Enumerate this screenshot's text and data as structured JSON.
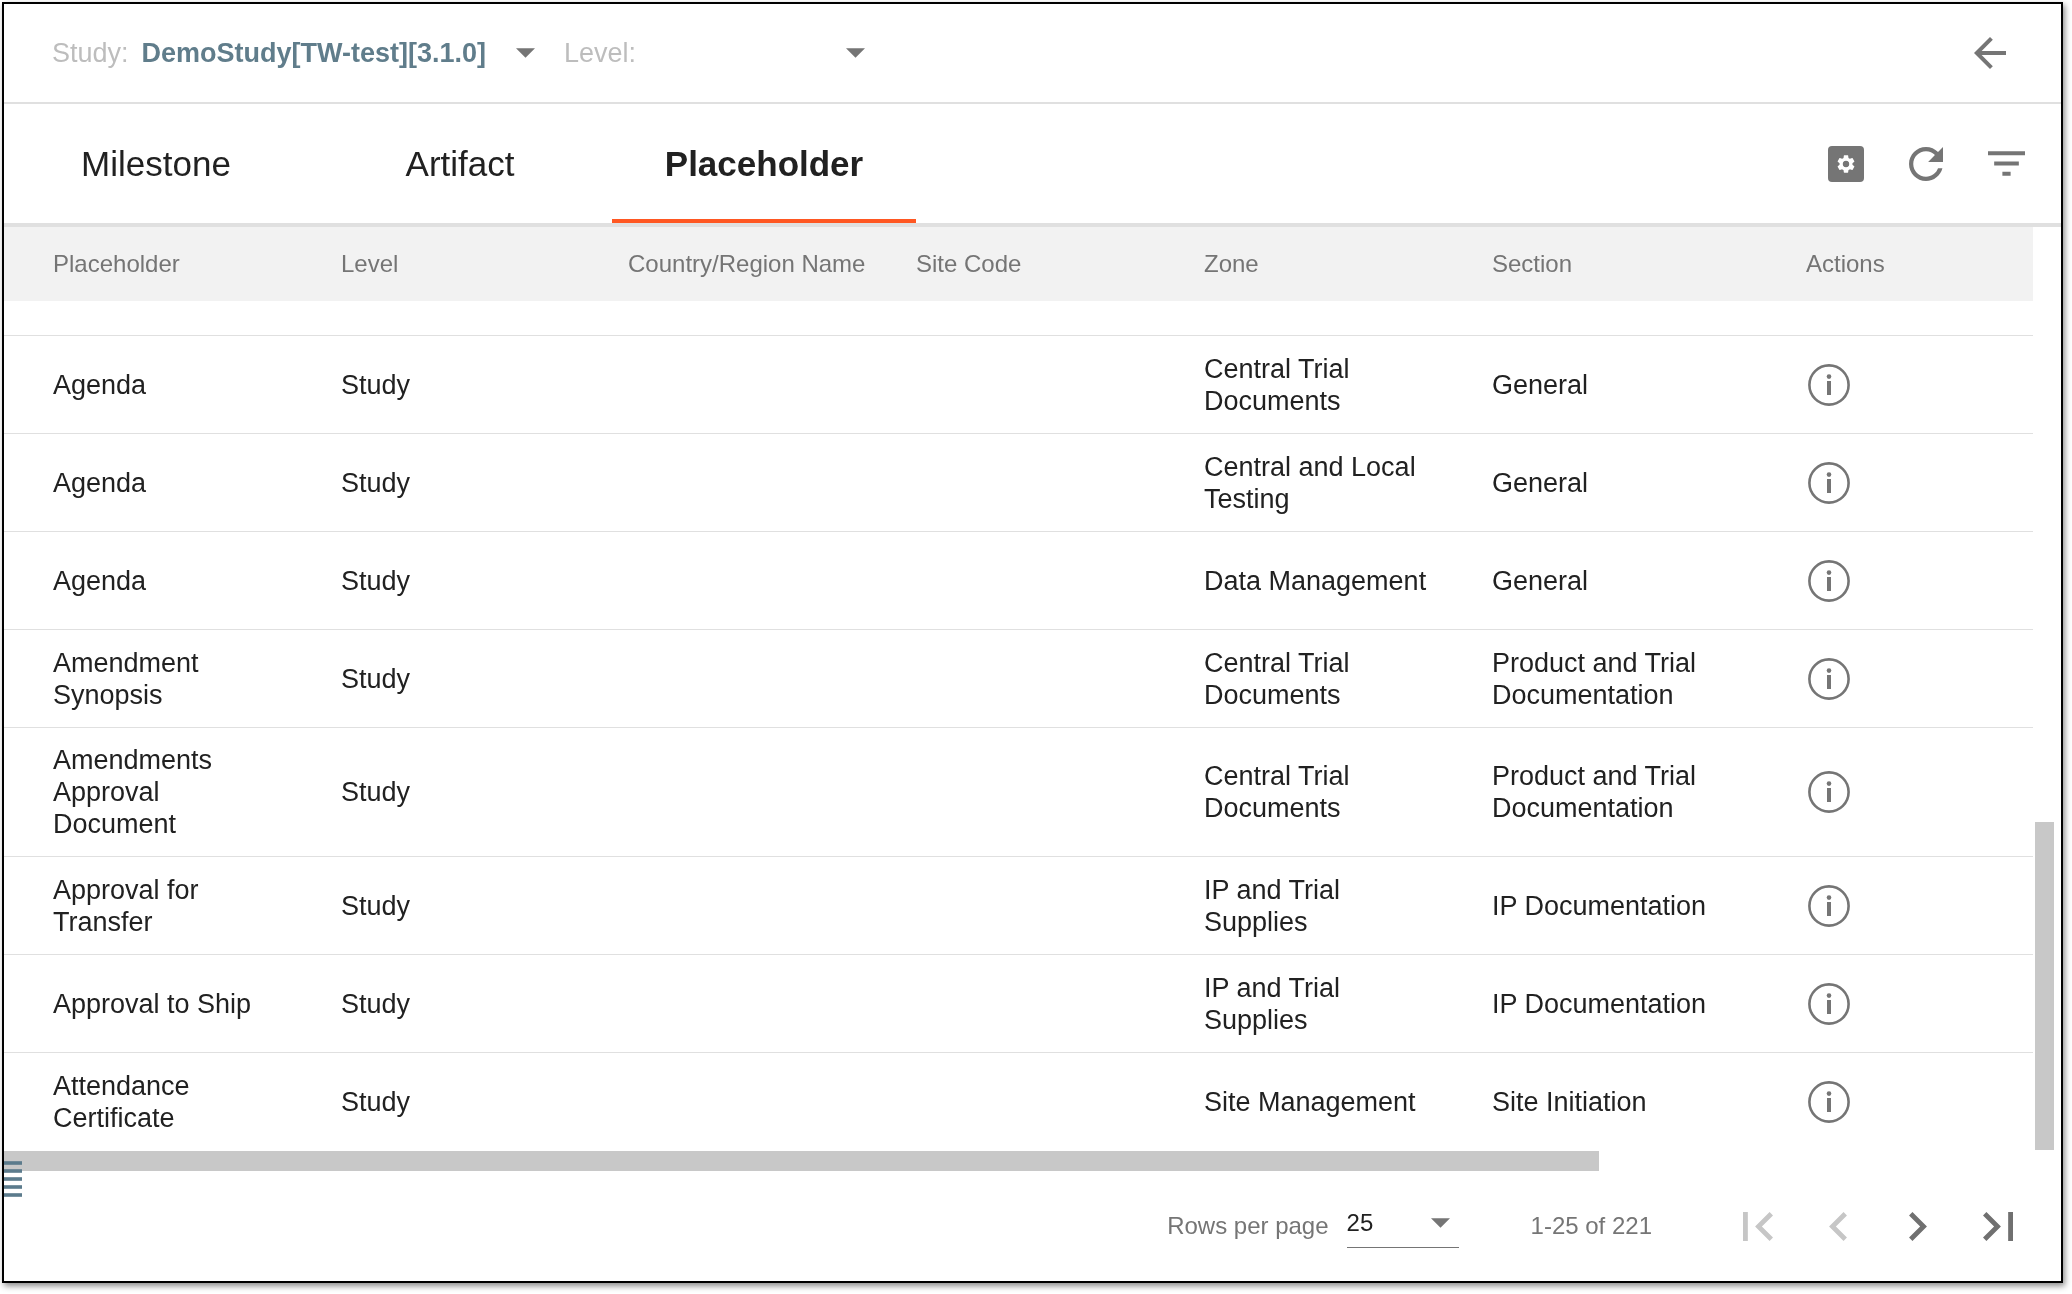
{
  "top_bar": {
    "study_select": {
      "label": "Study:",
      "value": "DemoStudy[TW-test][3.1.0]"
    },
    "level_select": {
      "label": "Level:"
    }
  },
  "tabs": [
    {
      "label": "Milestone",
      "selected": false
    },
    {
      "label": "Artifact",
      "selected": false
    },
    {
      "label": "Placeholder",
      "selected": true
    }
  ],
  "table": {
    "columns": [
      "Placeholder",
      "Level",
      "Country/Region Name",
      "Site Code",
      "Zone",
      "Section",
      "Actions"
    ],
    "rows": [
      {
        "placeholder": "Agenda",
        "level": "Study",
        "zone": "Central Trial Documents",
        "section": "General"
      },
      {
        "placeholder": "Agenda",
        "level": "Study",
        "zone": "Central and Local Testing",
        "section": "General"
      },
      {
        "placeholder": "Agenda",
        "level": "Study",
        "zone": "Data Management",
        "section": "General"
      },
      {
        "placeholder": "Amendment Synopsis",
        "level": "Study",
        "zone": "Central Trial Documents",
        "section": "Product and Trial Documentation"
      },
      {
        "placeholder": "Amendments Approval Document",
        "level": "Study",
        "zone": "Central Trial Documents",
        "section": "Product and Trial Documentation"
      },
      {
        "placeholder": "Approval for Transfer",
        "level": "Study",
        "zone": "IP and Trial Supplies",
        "section": "IP Documentation"
      },
      {
        "placeholder": "Approval to Ship",
        "level": "Study",
        "zone": "IP and Trial Supplies",
        "section": "IP Documentation"
      },
      {
        "placeholder": "Attendance Certificate",
        "level": "Study",
        "zone": "Site Management",
        "section": "Site Initiation"
      }
    ]
  },
  "pagination": {
    "rows_per_page_label": "Rows per page",
    "rows_per_page": "25",
    "range": "1-25 of 221",
    "buttons": [
      {
        "kind": "first",
        "disabled": true
      },
      {
        "kind": "previous",
        "disabled": true
      },
      {
        "kind": "next",
        "disabled": false
      },
      {
        "kind": "last",
        "disabled": false
      }
    ]
  }
}
